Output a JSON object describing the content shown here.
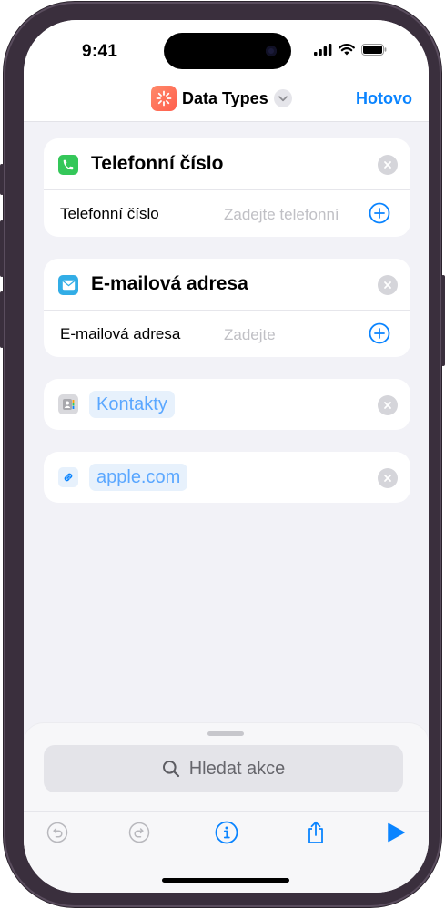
{
  "status_bar": {
    "time": "9:41"
  },
  "nav": {
    "title": "Data Types",
    "done_label": "Hotovo"
  },
  "cards": [
    {
      "title": "Telefonní číslo",
      "icon": "phone-icon",
      "icon_color": "#34c759",
      "row_label": "Telefonní číslo",
      "row_placeholder": "Zadejte telefonní"
    },
    {
      "title": "E-mailová adresa",
      "icon": "mail-icon",
      "icon_color": "#32ade6",
      "row_label": "E-mailová adresa",
      "row_placeholder": "Zadejte"
    }
  ],
  "variables": [
    {
      "label": "Kontakty",
      "icon": "contacts-icon"
    },
    {
      "label": "apple.com",
      "icon": "link-icon"
    }
  ],
  "search": {
    "placeholder": "Hledat akce"
  },
  "colors": {
    "accent": "#0a84ff",
    "token_bg": "#e7f1fc",
    "token_text": "#5aa7ff"
  }
}
